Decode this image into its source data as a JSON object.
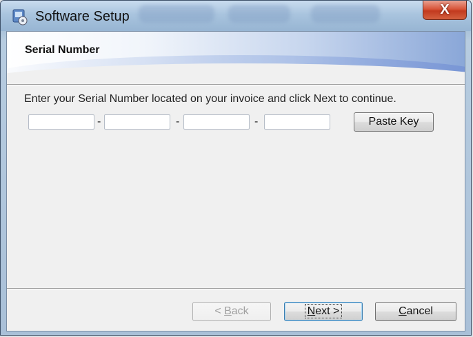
{
  "window": {
    "title": "Software Setup",
    "close_label": "X"
  },
  "header": {
    "title": "Serial Number"
  },
  "main": {
    "instructions": "Enter your Serial Number located on your invoice and click Next to continue.",
    "serial_fields": [
      {
        "value": ""
      },
      {
        "value": ""
      },
      {
        "value": ""
      },
      {
        "value": ""
      }
    ],
    "separator": "-",
    "paste_key_label": "Paste Key"
  },
  "footer": {
    "back": {
      "prefix": "< ",
      "accel": "B",
      "rest": "ack"
    },
    "next": {
      "accel": "N",
      "rest": "ext >"
    },
    "cancel": {
      "accel": "C",
      "rest": "ancel"
    }
  },
  "colors": {
    "accent": "#3c7fb1",
    "close": "#c23a1f"
  }
}
